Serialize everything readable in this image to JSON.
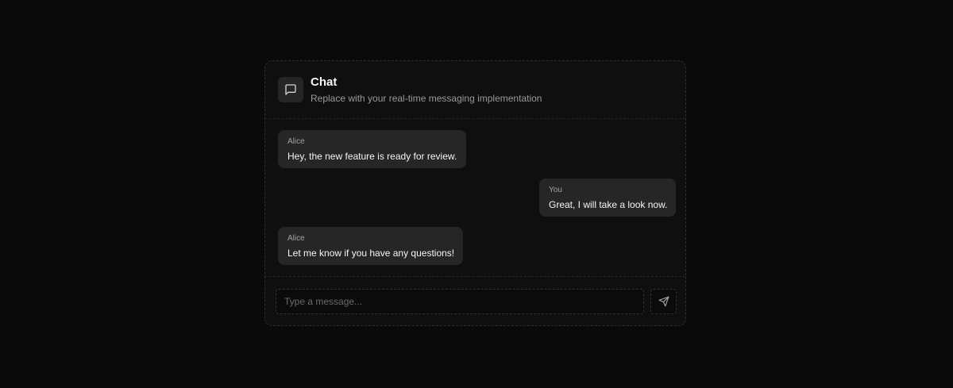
{
  "header": {
    "title": "Chat",
    "subtitle": "Replace with your real-time messaging implementation",
    "icon": "message-square-icon"
  },
  "messages": [
    {
      "sender": "Alice",
      "text": "Hey, the new feature is ready for review.",
      "align": "left"
    },
    {
      "sender": "You",
      "text": "Great, I will take a look now.",
      "align": "right"
    },
    {
      "sender": "Alice",
      "text": "Let me know if you have any questions!",
      "align": "left"
    }
  ],
  "composer": {
    "placeholder": "Type a message...",
    "value": "",
    "send_icon": "send-icon"
  },
  "colors": {
    "background": "#0a0a0a",
    "card": "#0f0f0f",
    "bubble": "#262626",
    "text": "#f5f5f5",
    "muted": "#9a9a9a"
  }
}
